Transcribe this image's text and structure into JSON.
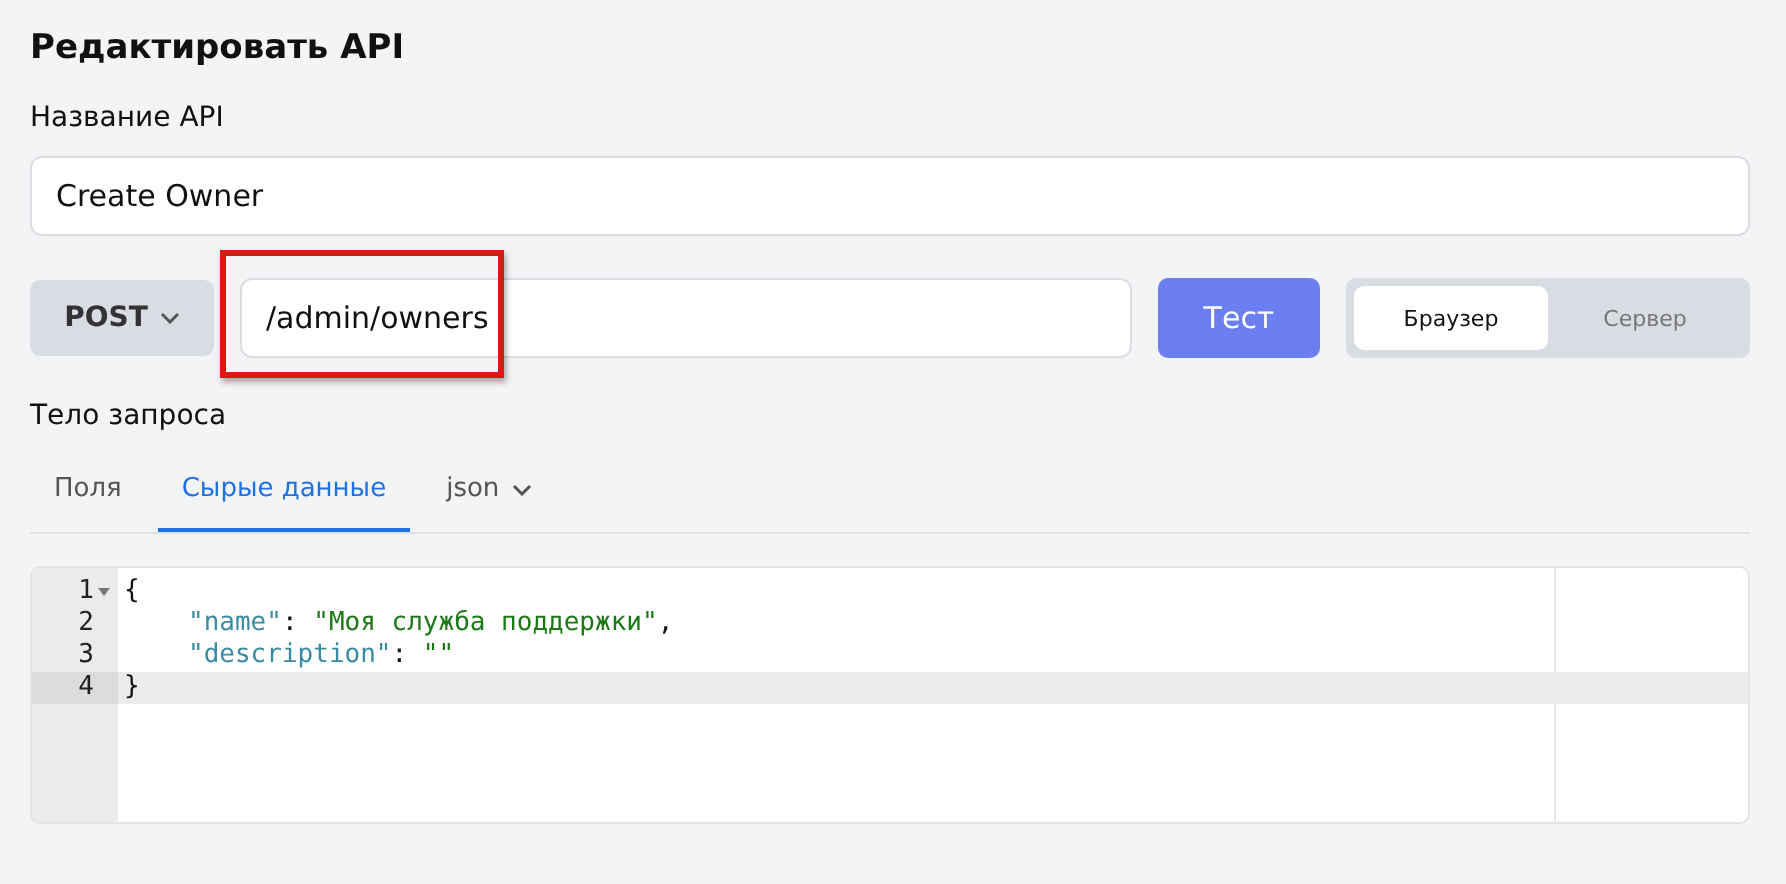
{
  "heading": "Редактировать API",
  "name_field": {
    "label": "Название API",
    "value": "Create Owner"
  },
  "request": {
    "method": "POST",
    "url": "/admin/owners",
    "url_highlighted": true,
    "test_button": "Тест",
    "modes": [
      {
        "label": "Браузер",
        "selected": true
      },
      {
        "label": "Сервер",
        "selected": false
      }
    ]
  },
  "body_label": "Тело запроса",
  "tabs": [
    {
      "label": "Поля",
      "selected": false,
      "kind": "plain"
    },
    {
      "label": "Сырые данные",
      "selected": true,
      "kind": "plain"
    },
    {
      "label": "json",
      "selected": false,
      "kind": "dropdown"
    }
  ],
  "editor": {
    "lines": [
      {
        "number": "1",
        "foldable": true,
        "active": false,
        "indented": false,
        "tokens": [
          {
            "kind": "punct",
            "text": "{"
          }
        ]
      },
      {
        "number": "2",
        "foldable": false,
        "active": false,
        "indented": true,
        "tokens": [
          {
            "kind": "key",
            "text": "\"name\""
          },
          {
            "kind": "punct",
            "text": ": "
          },
          {
            "kind": "string",
            "text": "\"Моя служба поддержки\""
          },
          {
            "kind": "punct",
            "text": ","
          }
        ]
      },
      {
        "number": "3",
        "foldable": false,
        "active": false,
        "indented": true,
        "tokens": [
          {
            "kind": "key",
            "text": "\"description\""
          },
          {
            "kind": "punct",
            "text": ": "
          },
          {
            "kind": "string",
            "text": "\"\""
          }
        ]
      },
      {
        "number": "4",
        "foldable": false,
        "active": true,
        "indented": false,
        "tokens": [
          {
            "kind": "punct",
            "text": "}"
          }
        ]
      }
    ]
  }
}
